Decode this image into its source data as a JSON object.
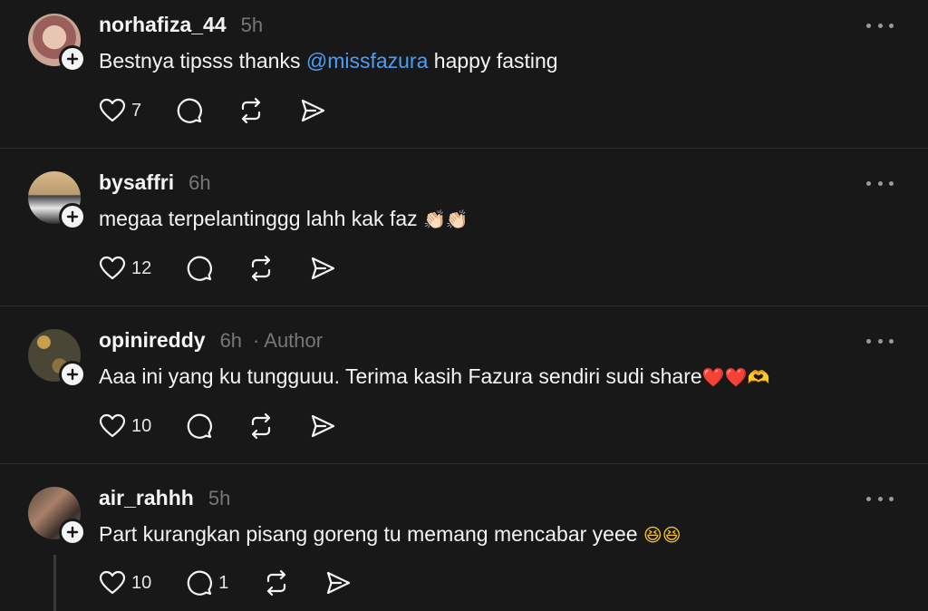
{
  "comments": [
    {
      "username": "norhafiza_44",
      "time": "5h",
      "text_before": "Bestnya tipsss thanks ",
      "mention": "@missfazura",
      "text_after": " happy fasting",
      "likes": "7",
      "replies": ""
    },
    {
      "username": "bysaffri",
      "time": "6h",
      "text": "megaa terpelantinggg lahh kak faz",
      "emoji": "👏🏻👏🏻",
      "likes": "12",
      "replies": ""
    },
    {
      "username": "opinireddy",
      "time": "6h",
      "author_label": "· Author",
      "text": "Aaa ini yang ku tungguuu. Terima kasih Fazura sendiri sudi share",
      "emoji": "❤️❤️🫶",
      "likes": "10",
      "replies": ""
    },
    {
      "username": "air_rahhh",
      "time": "5h",
      "text": "Part kurangkan pisang goreng tu memang mencabar yeee",
      "emoji": "😆😆",
      "likes": "10",
      "replies": "1"
    }
  ],
  "colors": {
    "background": "#181818",
    "text": "#f3f5f7",
    "muted": "#777777",
    "mention": "#4a9ff5",
    "divider": "#2d2d2d"
  },
  "icons": [
    "heart-icon",
    "comment-icon",
    "repost-icon",
    "share-icon",
    "more-icon",
    "follow-plus-icon"
  ]
}
